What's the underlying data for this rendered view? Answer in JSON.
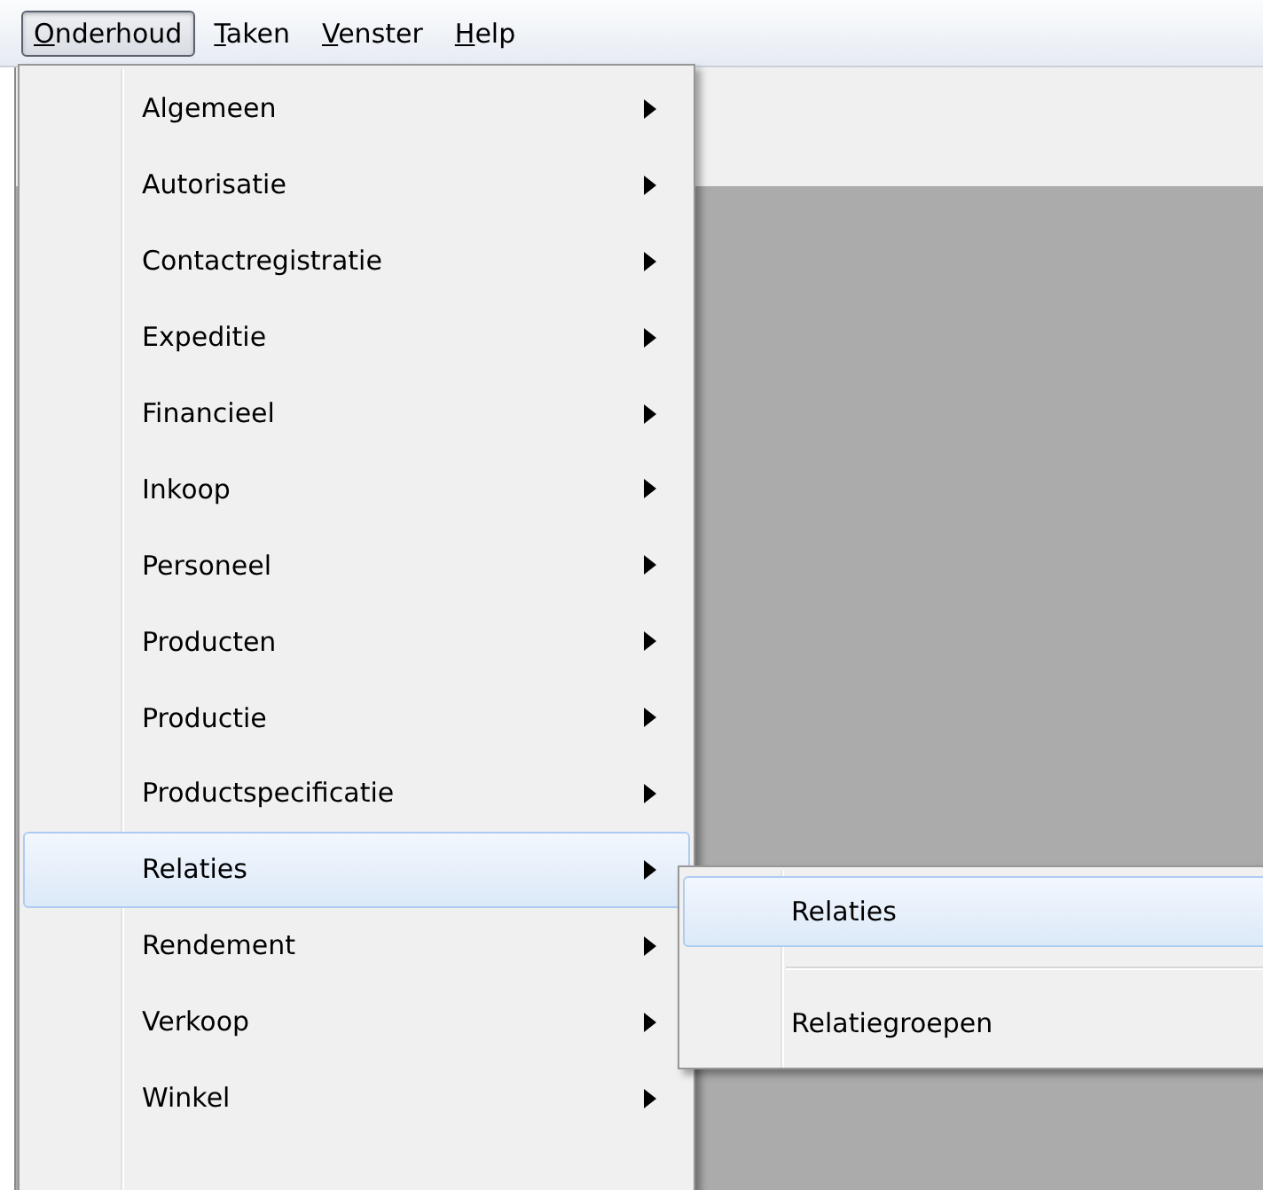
{
  "menu_bar": [
    {
      "label": "Onderhoud",
      "selected": true
    },
    {
      "label": "Taken",
      "selected": false
    },
    {
      "label": "Venster",
      "selected": false
    },
    {
      "label": "Help",
      "selected": false
    }
  ],
  "dropdown": [
    {
      "label": "Algemeen",
      "selected": false,
      "submenu": true
    },
    {
      "label": "Autorisatie",
      "selected": false,
      "submenu": true
    },
    {
      "label": "Contactregistratie",
      "selected": false,
      "submenu": true
    },
    {
      "label": "Expeditie",
      "selected": false,
      "submenu": true
    },
    {
      "label": "Financieel",
      "selected": false,
      "submenu": true
    },
    {
      "label": "Inkoop",
      "selected": false,
      "submenu": true
    },
    {
      "label": "Personeel",
      "selected": false,
      "submenu": true
    },
    {
      "label": "Producten",
      "selected": false,
      "submenu": true
    },
    {
      "label": "Productie",
      "selected": false,
      "submenu": true
    },
    {
      "label": "Productspecificatie",
      "selected": false,
      "submenu": true
    },
    {
      "label": "Relaties",
      "selected": true,
      "submenu": true
    },
    {
      "label": "Rendement",
      "selected": false,
      "submenu": true
    },
    {
      "label": "Verkoop",
      "selected": false,
      "submenu": true
    },
    {
      "label": "Winkel",
      "selected": false,
      "submenu": true
    }
  ],
  "submenu": [
    {
      "kind": "item",
      "label": "Relaties",
      "selected": true
    },
    {
      "kind": "separator"
    },
    {
      "kind": "item",
      "label": "Relatiegroepen",
      "selected": false
    }
  ]
}
